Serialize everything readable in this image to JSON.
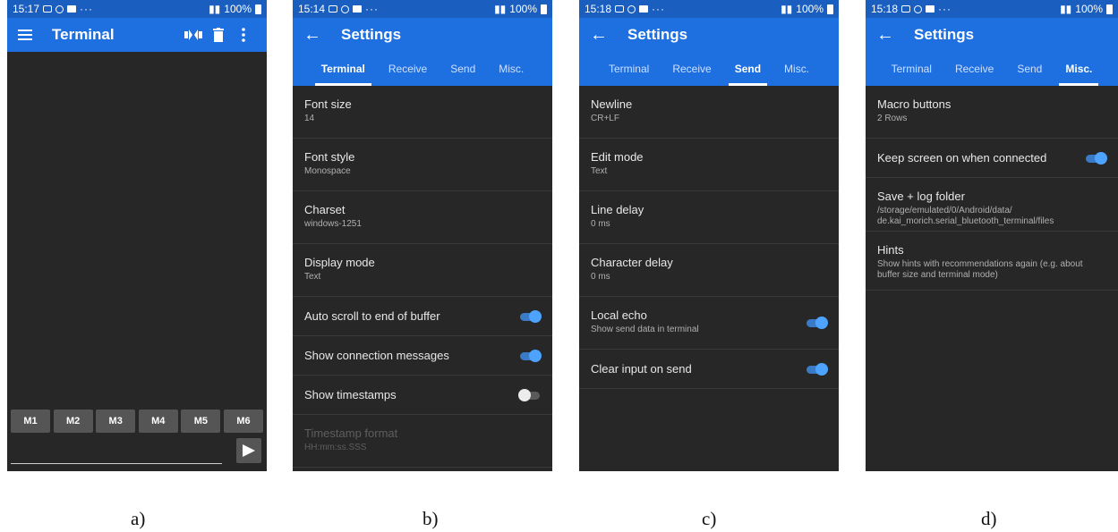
{
  "panels": [
    {
      "status": {
        "time": "15:17",
        "right": "100%"
      },
      "appbar": {
        "title": "Terminal"
      },
      "macros": [
        "M1",
        "M2",
        "M3",
        "M4",
        "M5",
        "M6"
      ],
      "caption": "a)"
    },
    {
      "status": {
        "time": "15:14",
        "right": "100%"
      },
      "appbar": {
        "title": "Settings"
      },
      "tabs": [
        "Terminal",
        "Receive",
        "Send",
        "Misc."
      ],
      "active_tab": "Terminal",
      "settings": [
        {
          "title": "Font size",
          "sub": "14"
        },
        {
          "title": "Font style",
          "sub": "Monospace"
        },
        {
          "title": "Charset",
          "sub": "windows-1251"
        },
        {
          "title": "Display mode",
          "sub": "Text"
        },
        {
          "title": "Auto scroll to end of buffer",
          "toggle": true
        },
        {
          "title": "Show connection messages",
          "toggle": true
        },
        {
          "title": "Show timestamps",
          "toggle": false
        },
        {
          "title": "Timestamp format",
          "sub": "HH:mm:ss.SSS",
          "disabled": true
        }
      ],
      "caption": "b)"
    },
    {
      "status": {
        "time": "15:18",
        "right": "100%"
      },
      "appbar": {
        "title": "Settings"
      },
      "tabs": [
        "Terminal",
        "Receive",
        "Send",
        "Misc."
      ],
      "active_tab": "Send",
      "settings": [
        {
          "title": "Newline",
          "sub": "CR+LF"
        },
        {
          "title": "Edit mode",
          "sub": "Text"
        },
        {
          "title": "Line delay",
          "sub": "0 ms"
        },
        {
          "title": "Character delay",
          "sub": "0 ms"
        },
        {
          "title": "Local echo",
          "sub": "Show send data in terminal",
          "toggle": true
        },
        {
          "title": "Clear input on send",
          "toggle": true
        }
      ],
      "caption": "c)"
    },
    {
      "status": {
        "time": "15:18",
        "right": "100%"
      },
      "appbar": {
        "title": "Settings"
      },
      "tabs": [
        "Terminal",
        "Receive",
        "Send",
        "Misc."
      ],
      "active_tab": "Misc.",
      "settings": [
        {
          "title": "Macro buttons",
          "sub": "2 Rows"
        },
        {
          "title": "Keep screen on when connected",
          "toggle": true
        },
        {
          "title": "Save + log folder",
          "sub": "/storage/emulated/0/Android/data/ de.kai_morich.serial_bluetooth_terminal/files"
        },
        {
          "title": "Hints",
          "sub": "Show hints with recommendations again (e.g. about buffer size and terminal mode)"
        }
      ],
      "caption": "d)"
    }
  ],
  "colors": {
    "statusbar": "#1a5fbf",
    "appbar": "#1e6fe0",
    "background": "#272727",
    "toggle_on": "#4ea3ff",
    "macro_button": "#555555"
  },
  "icons": [
    "menu-icon",
    "bluetooth-connect-icon",
    "trash-icon",
    "more-vert-icon",
    "back-arrow-icon",
    "send-icon"
  ]
}
